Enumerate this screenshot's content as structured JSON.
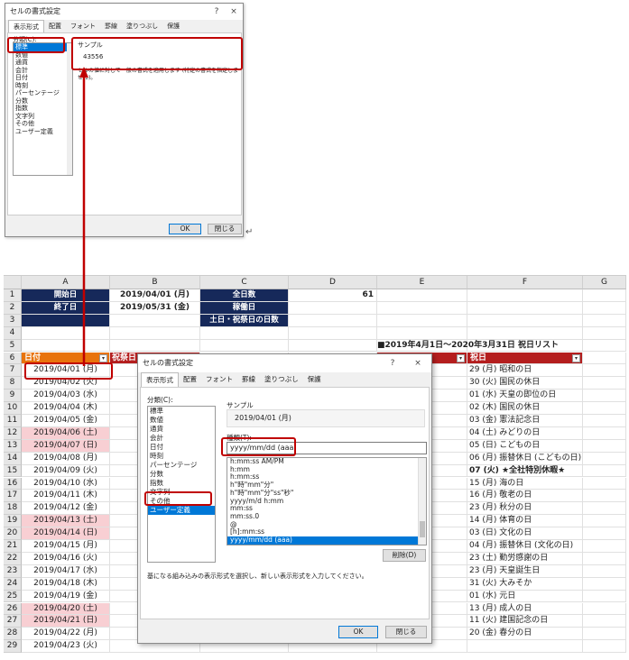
{
  "dialog_top": {
    "title": "セルの書式設定",
    "help": "?",
    "close": "×",
    "tabs": [
      "表示形式",
      "配置",
      "フォント",
      "罫線",
      "塗りつぶし",
      "保護"
    ],
    "category_label": "分類(C):",
    "categories": [
      "標準",
      "数値",
      "通貨",
      "会計",
      "日付",
      "時刻",
      "パーセンテージ",
      "分数",
      "指数",
      "文字列",
      "その他",
      "ユーザー定義"
    ],
    "selected_category": "標準",
    "sample_label": "サンプル",
    "sample_value": "43556",
    "description": "セルの値に対して一般の書式を適用します (特定の書式を指定しません)。",
    "ok": "OK",
    "cancel": "閉じる"
  },
  "return_mark": "↵",
  "sheet": {
    "columns": [
      "A",
      "B",
      "C",
      "D",
      "E",
      "F",
      "G"
    ],
    "rows": [
      {
        "n": "1",
        "a": "開始日",
        "b": "2019/04/01 (月)",
        "c": "全日数",
        "d": "61"
      },
      {
        "n": "2",
        "a": "終了日",
        "b": "2019/05/31 (金)",
        "c": "稼働日",
        "d": ""
      },
      {
        "n": "3",
        "a": "",
        "b": "",
        "c": "土日・祝祭日の日数",
        "d": ""
      },
      {
        "n": "4"
      },
      {
        "n": "5",
        "e": "■2019年4月1日～2020年3月31日 祝日リスト"
      },
      {
        "n": "6",
        "a": "日付",
        "a2": "祝祭日",
        "e": "",
        "f": "祝日"
      },
      {
        "n": "7",
        "a": "2019/04/01 (月)",
        "f": "29 (月) 昭和の日"
      },
      {
        "n": "8",
        "a": "2019/04/02 (火)",
        "f": "30 (火) 国民の休日"
      },
      {
        "n": "9",
        "a": "2019/04/03 (水)",
        "f": "01 (水) 天皇の即位の日"
      },
      {
        "n": "10",
        "a": "2019/04/04 (木)",
        "f": "02 (木) 国民の休日"
      },
      {
        "n": "11",
        "a": "2019/04/05 (金)",
        "f": "03 (金) 憲法記念日"
      },
      {
        "n": "12",
        "a": "2019/04/06 (土)",
        "pink": true,
        "f": "04 (土) みどりの日"
      },
      {
        "n": "13",
        "a": "2019/04/07 (日)",
        "pink": true,
        "f": "05 (日) こどもの日"
      },
      {
        "n": "14",
        "a": "2019/04/08 (月)",
        "f": "06 (月) 振替休日 (こどもの日)"
      },
      {
        "n": "15",
        "a": "2019/04/09 (火)",
        "f": "07 (火) ★全社特別休暇★",
        "bold": true
      },
      {
        "n": "16",
        "a": "2019/04/10 (水)",
        "f": "15 (月) 海の日"
      },
      {
        "n": "17",
        "a": "2019/04/11 (木)",
        "f": "16 (月) 敬老の日"
      },
      {
        "n": "18",
        "a": "2019/04/12 (金)",
        "f": "23 (月) 秋分の日"
      },
      {
        "n": "19",
        "a": "2019/04/13 (土)",
        "pink": true,
        "f": "14 (月) 体育の日"
      },
      {
        "n": "20",
        "a": "2019/04/14 (日)",
        "pink": true,
        "f": "03 (日) 文化の日"
      },
      {
        "n": "21",
        "a": "2019/04/15 (月)",
        "f": "04 (月) 振替休日 (文化の日)"
      },
      {
        "n": "22",
        "a": "2019/04/16 (火)",
        "f": "23 (土) 勤労感謝の日"
      },
      {
        "n": "23",
        "a": "2019/04/17 (水)",
        "f": "23 (月) 天皇誕生日"
      },
      {
        "n": "24",
        "a": "2019/04/18 (木)",
        "f": "31 (火) 大みそか"
      },
      {
        "n": "25",
        "a": "2019/04/19 (金)",
        "f": "01 (水) 元日"
      },
      {
        "n": "26",
        "a": "2019/04/20 (土)",
        "pink": true,
        "f": "13 (月) 成人の日"
      },
      {
        "n": "27",
        "a": "2019/04/21 (日)",
        "pink": true,
        "f": "11 (火) 建国記念の日"
      },
      {
        "n": "28",
        "a": "2019/04/22 (月)",
        "f": "20 (金) 春分の日"
      },
      {
        "n": "29",
        "a": "2019/04/23 (火)"
      }
    ]
  },
  "dialog_bottom": {
    "title": "セルの書式設定",
    "help": "?",
    "close": "×",
    "tabs": [
      "表示形式",
      "配置",
      "フォント",
      "罫線",
      "塗りつぶし",
      "保護"
    ],
    "category_label": "分類(C):",
    "categories": [
      "標準",
      "数値",
      "通貨",
      "会計",
      "日付",
      "時刻",
      "パーセンテージ",
      "分数",
      "指数",
      "文字列",
      "その他",
      "ユーザー定義"
    ],
    "selected_category": "ユーザー定義",
    "sample_label": "サンプル",
    "sample_value": "2019/04/01 (月)",
    "type_label": "種類(T):",
    "type_value": "yyyy/mm/dd (aaa)",
    "format_list": [
      "h:mm:ss AM/PM",
      "h:mm",
      "h:mm:ss",
      "h\"時\"mm\"分\"",
      "h\"時\"mm\"分\"ss\"秒\"",
      "yyyy/m/d h:mm",
      "mm:ss",
      "mm:ss.0",
      "@",
      "[h]:mm:ss",
      "yyyy/mm/dd (aaa)"
    ],
    "selected_format": "yyyy/mm/dd (aaa)",
    "delete": "削除(D)",
    "description": "基になる組み込みの表示形式を選択し、新しい表示形式を入力してください。",
    "ok": "OK",
    "cancel": "閉じる"
  },
  "colors": {
    "navy": "#16295a",
    "red_header": "#b41e1e",
    "pink": "#f8cfd3",
    "highlight": "#c00000",
    "selection": "#0078d7"
  }
}
